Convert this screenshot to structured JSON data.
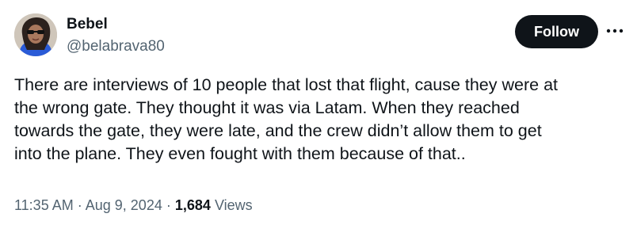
{
  "author": {
    "display_name": "Bebel",
    "handle": "@belabrava80"
  },
  "actions": {
    "follow_label": "Follow",
    "more_icon": "more-horizontal-icon"
  },
  "tweet": {
    "text_lines": [
      "There are interviews of 10 people that lost that flight, cause they were at",
      "the wrong gate. They thought it was via Latam. When they reached",
      "towards the gate, they were late, and the crew didn’t allow them to get",
      "into the plane. They even fought with them because of that.."
    ],
    "time": "11:35 AM",
    "separator": "·",
    "date": "Aug 9, 2024",
    "views_count": "1,684",
    "views_label": "Views"
  },
  "colors": {
    "text_primary": "#0f1419",
    "text_secondary": "#536471",
    "button_bg": "#0f1419",
    "button_text": "#ffffff"
  }
}
